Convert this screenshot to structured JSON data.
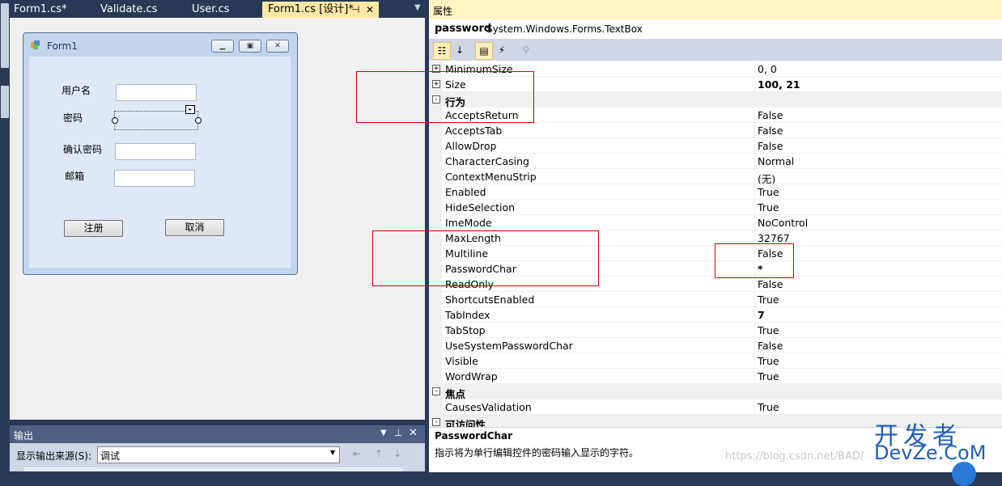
{
  "tabs": [
    {
      "label": "Form1.cs*"
    },
    {
      "label": "Validate.cs"
    },
    {
      "label": "User.cs"
    },
    {
      "label": "Form1.cs [设计]*",
      "active": true
    }
  ],
  "tab_icons": {
    "pin": "pin-icon",
    "close": "close-icon"
  },
  "designer": {
    "form_title": "Form1",
    "fields": [
      {
        "label": "用户名"
      },
      {
        "label": "密码"
      },
      {
        "label": "确认密码"
      },
      {
        "label": "邮箱"
      }
    ],
    "register_button": "注册",
    "cancel_button": "取消"
  },
  "output": {
    "title": "输出",
    "source_label": "显示输出来源(S):",
    "source_value": "调试"
  },
  "properties": {
    "header": "属性",
    "object_name": "password",
    "object_type": "System.Windows.Forms.TextBox",
    "rows": [
      {
        "kind": "prop",
        "expander": "+",
        "name": "MinimumSize",
        "value": "0, 0"
      },
      {
        "kind": "prop",
        "expander": "+",
        "name": "Size",
        "value": "100, 21",
        "bold": true
      },
      {
        "kind": "cat",
        "expander": "-",
        "name": "行为"
      },
      {
        "kind": "prop",
        "name": "AcceptsReturn",
        "value": "False"
      },
      {
        "kind": "prop",
        "name": "AcceptsTab",
        "value": "False"
      },
      {
        "kind": "prop",
        "name": "AllowDrop",
        "value": "False"
      },
      {
        "kind": "prop",
        "name": "CharacterCasing",
        "value": "Normal"
      },
      {
        "kind": "prop",
        "name": "ContextMenuStrip",
        "value": "(无)"
      },
      {
        "kind": "prop",
        "name": "Enabled",
        "value": "True"
      },
      {
        "kind": "prop",
        "name": "HideSelection",
        "value": "True"
      },
      {
        "kind": "prop",
        "name": "ImeMode",
        "value": "NoControl"
      },
      {
        "kind": "prop",
        "name": "MaxLength",
        "value": "32767"
      },
      {
        "kind": "prop",
        "name": "Multiline",
        "value": "False"
      },
      {
        "kind": "prop",
        "name": "PasswordChar",
        "value": "*",
        "bold": true
      },
      {
        "kind": "prop",
        "name": "ReadOnly",
        "value": "False"
      },
      {
        "kind": "prop",
        "name": "ShortcutsEnabled",
        "value": "True"
      },
      {
        "kind": "prop",
        "name": "TabIndex",
        "value": "7",
        "bold": true
      },
      {
        "kind": "prop",
        "name": "TabStop",
        "value": "True"
      },
      {
        "kind": "prop",
        "name": "UseSystemPasswordChar",
        "value": "False"
      },
      {
        "kind": "prop",
        "name": "Visible",
        "value": "True"
      },
      {
        "kind": "prop",
        "name": "WordWrap",
        "value": "True"
      },
      {
        "kind": "cat",
        "expander": "-",
        "name": "焦点"
      },
      {
        "kind": "prop",
        "name": "CausesValidation",
        "value": "True"
      },
      {
        "kind": "cat",
        "expander": "-",
        "name": "可访问性"
      }
    ],
    "description_title": "PasswordChar",
    "description_text": "指示将为单行编辑控件的密码输入显示的字符。"
  },
  "watermark": {
    "url": "https://blog.csdn.net/BAD/",
    "logo_top": "开发者",
    "logo_bottom": "DevZe.CoM"
  },
  "colors": {
    "accent_tab": "#ffe8a6",
    "annotation_red": "#d60000",
    "ide_dark": "#293955"
  }
}
